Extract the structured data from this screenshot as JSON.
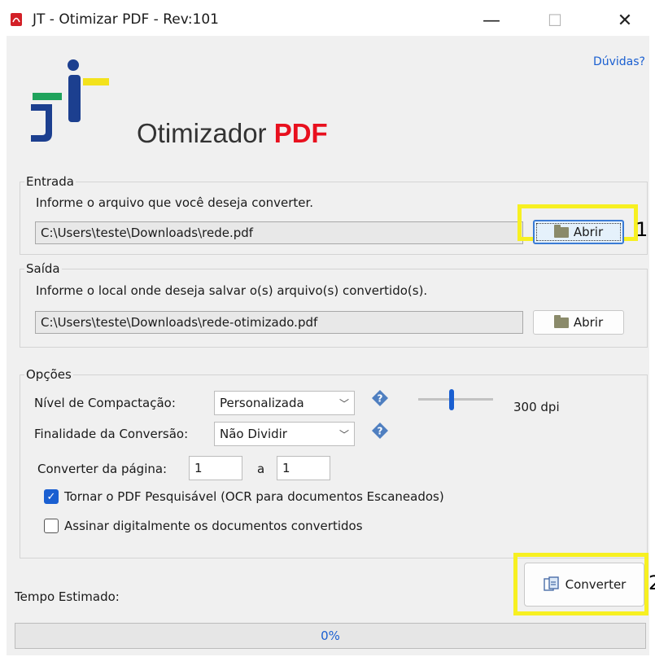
{
  "window": {
    "title": "JT - Otimizar PDF - Rev:101",
    "minimize_glyph": "—",
    "maximize_glyph": "☐",
    "close_glyph": "✕"
  },
  "header": {
    "help_link": "Dúvidas?",
    "app_title_prefix": "Otimizador",
    "app_title_suffix": "PDF"
  },
  "entrada": {
    "group_label": "Entrada",
    "hint": "Informe o arquivo que você deseja converter.",
    "path": "C:\\Users\\teste\\Downloads\\rede.pdf",
    "open_label": "Abrir",
    "callout": "1"
  },
  "saida": {
    "group_label": "Saída",
    "hint": "Informe o local onde deseja salvar o(s) arquivo(s) convertido(s).",
    "path": "C:\\Users\\teste\\Downloads\\rede-otimizado.pdf",
    "open_label": "Abrir"
  },
  "opcoes": {
    "group_label": "Opções",
    "compact_label": "Nível de Compactação:",
    "compact_value": "Personalizada",
    "dpi_label": "300 dpi",
    "dpi_slider_fraction": 0.45,
    "purpose_label": "Finalidade da Conversão:",
    "purpose_value": "Não Dividir",
    "page_from_label": "Converter da página:",
    "page_from_value": "1",
    "page_to_label": "a",
    "page_to_value": "1",
    "ocr_label": "Tornar o PDF Pesquisável (OCR para documentos Escaneados)",
    "ocr_checked": true,
    "sign_label": "Assinar digitalmente os documentos convertidos",
    "sign_checked": false
  },
  "footer": {
    "estimated_label": "Tempo Estimado:",
    "convert_label": "Converter",
    "callout": "2",
    "progress_percent": 0,
    "progress_text": "0%"
  },
  "colors": {
    "accent": "#1a5fd1",
    "highlight": "#f7f021",
    "pdf_red": "#e8101e",
    "logo_blue": "#1c3f8f",
    "logo_green": "#1fa35c",
    "logo_yellow": "#f3e21c"
  }
}
